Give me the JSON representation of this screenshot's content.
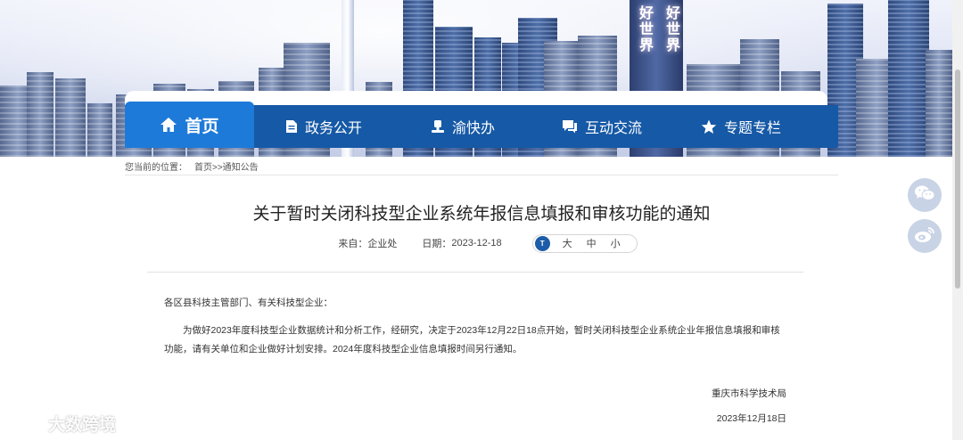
{
  "nav": {
    "items": [
      {
        "label": "首页",
        "icon": "home-icon"
      },
      {
        "label": "政务公开",
        "icon": "document-icon"
      },
      {
        "label": "渝快办",
        "icon": "stamp-icon"
      },
      {
        "label": "互动交流",
        "icon": "chat-icon"
      },
      {
        "label": "专题专栏",
        "icon": "star-icon"
      }
    ]
  },
  "breadcrumb": {
    "prefix": "您当前的位置：",
    "items": [
      "首页",
      ">>通知公告"
    ]
  },
  "article": {
    "title": "关于暂时关闭科技型企业系统年报信息填报和审核功能的通知",
    "source_label": "来自：",
    "source_value": "企业处",
    "date_label": "日期：",
    "date_value": "2023-12-18",
    "font_icon_text": "T",
    "font_sizes": [
      "大",
      "中",
      "小"
    ],
    "greeting": "各区县科技主管部门、有关科技型企业：",
    "paragraph": "为做好2023年度科技型企业数据统计和分析工作，经研究，决定于2023年12月22日18点开始，暂时关闭科技型企业系统企业年报信息填报和审核功能，请有关单位和企业做好计划安排。2024年度科技型企业信息填报时间另行通知。",
    "signature": "重庆市科学技术局",
    "sign_date": "2023年12月18日"
  },
  "banner": {
    "tower_text_1": "好世界",
    "tower_text_2": "好世界"
  },
  "share": {
    "icons": [
      "wechat-icon",
      "weibo-icon"
    ]
  },
  "watermark": {
    "text": "大数跨境"
  },
  "colors": {
    "nav_bg": "#1659a6",
    "nav_active": "#1e7ad8",
    "share_bg": "#c9d3e6"
  }
}
